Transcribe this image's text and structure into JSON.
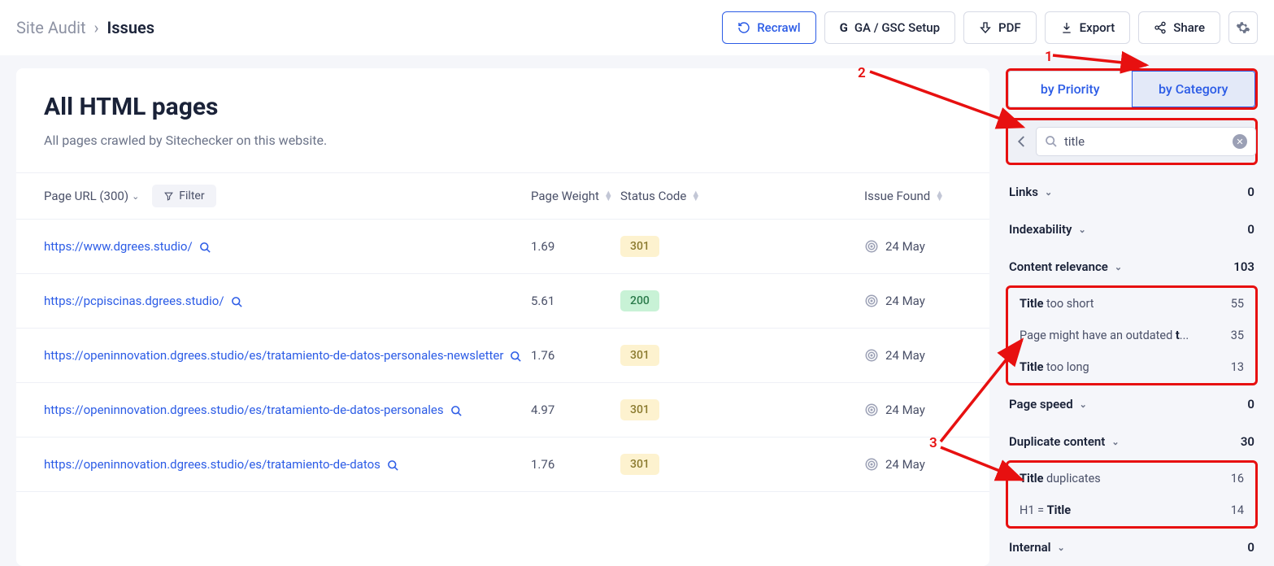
{
  "breadcrumb": {
    "parent": "Site Audit",
    "current": "Issues"
  },
  "topbar": {
    "recrawl": "Recrawl",
    "gasetup": "GA / GSC Setup",
    "pdf": "PDF",
    "export": "Export",
    "share": "Share"
  },
  "main": {
    "title": "All HTML pages",
    "subtitle": "All pages crawled by Sitechecker on this website."
  },
  "table": {
    "headers": {
      "url": "Page URL (300)",
      "filter": "Filter",
      "weight": "Page Weight",
      "status": "Status Code",
      "issue": "Issue Found"
    },
    "rows": [
      {
        "url": "https://www.dgrees.studio/",
        "weight": "1.69",
        "status": "301",
        "statusClass": "s301",
        "date": "24 May"
      },
      {
        "url": "https://pcpiscinas.dgrees.studio/",
        "weight": "5.61",
        "status": "200",
        "statusClass": "s200",
        "date": "24 May"
      },
      {
        "url": "https://openinnovation.dgrees.studio/es/tratamiento-de-datos-personales-newsletter",
        "weight": "1.76",
        "status": "301",
        "statusClass": "s301",
        "date": "24 May"
      },
      {
        "url": "https://openinnovation.dgrees.studio/es/tratamiento-de-datos-personales",
        "weight": "4.97",
        "status": "301",
        "statusClass": "s301",
        "date": "24 May"
      },
      {
        "url": "https://openinnovation.dgrees.studio/es/tratamiento-de-datos",
        "weight": "1.76",
        "status": "301",
        "statusClass": "s301",
        "date": "24 May"
      }
    ]
  },
  "sidebar": {
    "tabs": {
      "priority": "by Priority",
      "category": "by Category"
    },
    "search": {
      "value": "title"
    },
    "categories": [
      {
        "name": "Links",
        "count": "0"
      },
      {
        "name": "Indexability",
        "count": "0"
      },
      {
        "name": "Content relevance",
        "count": "103",
        "items": [
          {
            "pre": "Title",
            "post": " too short",
            "count": "55"
          },
          {
            "pre": "",
            "mid": "Page might have an outdated ",
            "bold": "t",
            "post": "...",
            "count": "35"
          },
          {
            "pre": "Title",
            "post": " too long",
            "count": "13"
          }
        ]
      },
      {
        "name": "Page speed",
        "count": "0"
      },
      {
        "name": "Duplicate content",
        "count": "30",
        "items": [
          {
            "pre": "Title",
            "post": " duplicates",
            "count": "16"
          },
          {
            "mid": "H1 = ",
            "pre": "Title",
            "count": "14"
          }
        ]
      },
      {
        "name": "Internal",
        "count": "0"
      }
    ]
  },
  "annotations": {
    "n1": "1",
    "n2": "2",
    "n3": "3"
  }
}
